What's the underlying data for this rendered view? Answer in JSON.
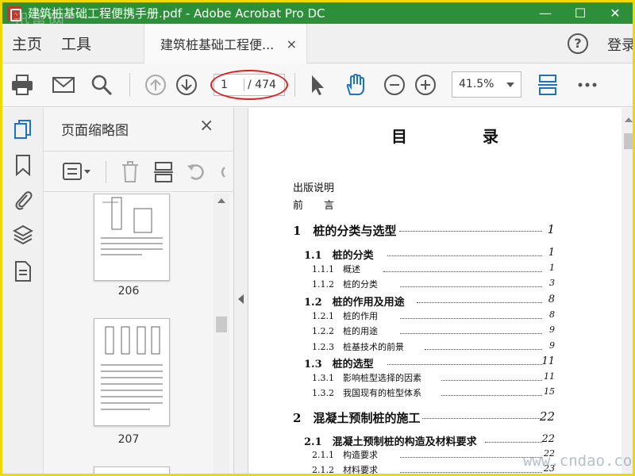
{
  "window": {
    "title": "建筑桩基础工程便携手册.pdf - Adobe Acrobat Pro DC",
    "watermark_top": "迅雷网",
    "watermark_bottom": "www.cndao.com"
  },
  "menubar": {
    "home": "主页",
    "tools": "工具",
    "doc_tab": "建筑桩基础工程便...",
    "doc_tab_close": "×",
    "help": "?",
    "login": "登录"
  },
  "toolbar": {
    "current_page": "1",
    "total_pages": "/ 474",
    "zoom": "41.5%"
  },
  "thumbpanel": {
    "title": "页面缩略图",
    "close": "×",
    "thumbnails": [
      {
        "label": "206"
      },
      {
        "label": "207"
      }
    ]
  },
  "document": {
    "heading": "目 录",
    "toc": [
      {
        "text": "出版说明",
        "page": ""
      },
      {
        "text": "前　　言",
        "page": ""
      },
      {
        "text": "1　桩的分类与选型",
        "page": "1"
      },
      {
        "text": "1.1　桩的分类",
        "page": "1"
      },
      {
        "text": "1.1.1　概述",
        "page": "1"
      },
      {
        "text": "1.1.2　桩的分类",
        "page": "3"
      },
      {
        "text": "1.2　桩的作用及用途",
        "page": "8"
      },
      {
        "text": "1.2.1　桩的作用",
        "page": "8"
      },
      {
        "text": "1.2.2　桩的用途",
        "page": "9"
      },
      {
        "text": "1.2.3　桩基技术的前景",
        "page": "9"
      },
      {
        "text": "1.3　桩的选型",
        "page": "11"
      },
      {
        "text": "1.3.1　影响桩型选择的因素",
        "page": "11"
      },
      {
        "text": "1.3.2　我国现有的桩型体系",
        "page": "15"
      },
      {
        "text": "2　混凝土预制桩的施工",
        "page": "22"
      },
      {
        "text": "2.1　混凝土预制桩的构造及材料要求",
        "page": "22"
      },
      {
        "text": "2.1.1　构造要求",
        "page": "22"
      },
      {
        "text": "2.1.2　材料要求",
        "page": "23"
      }
    ]
  }
}
